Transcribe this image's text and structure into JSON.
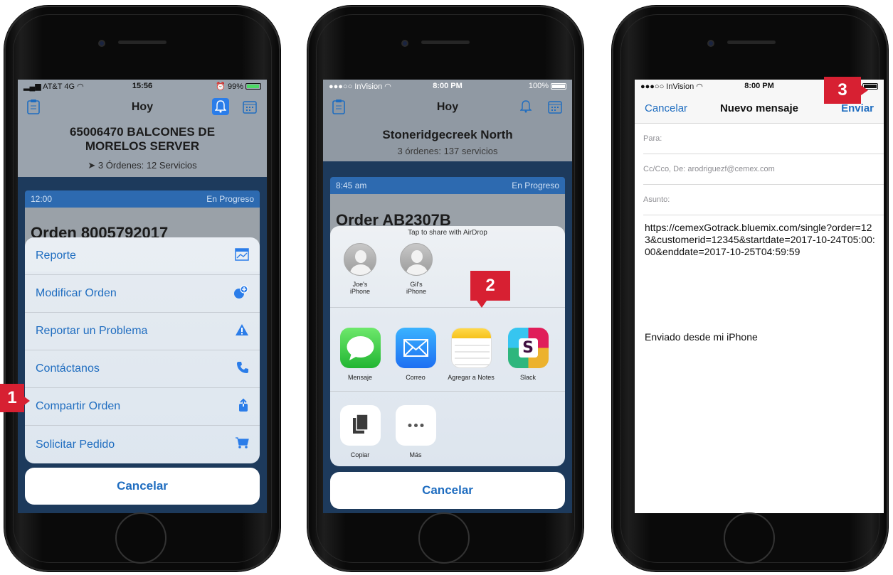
{
  "colors": {
    "accent": "#1f6dc0",
    "badge": "#d72032",
    "progress_bar": "#2d6ab0"
  },
  "phone1": {
    "status": {
      "carrier": "AT&T 4G",
      "time": "15:56",
      "battery": "99%"
    },
    "header_title": "Hoy",
    "site_name": "65006470 BALCONES DE MORELOS SERVER",
    "orders_summary": "3 Órdenes: 12 Servicios",
    "card_time": "12:00",
    "card_status": "En Progreso",
    "order_title": "Orden 8005792017",
    "menu": [
      {
        "label": "Reporte",
        "icon": "report-icon"
      },
      {
        "label": "Modificar Orden",
        "icon": "edit-order-icon"
      },
      {
        "label": "Reportar un Problema",
        "icon": "warning-icon"
      },
      {
        "label": "Contáctanos",
        "icon": "phone-icon"
      },
      {
        "label": "Compartir Orden",
        "icon": "share-icon"
      },
      {
        "label": "Solicitar Pedido",
        "icon": "cart-icon"
      }
    ],
    "cancel": "Cancelar",
    "step": "1"
  },
  "phone2": {
    "status": {
      "carrier": "●●●○○ InVision",
      "time": "8:00 PM",
      "battery": "100%"
    },
    "header_title": "Hoy",
    "site_name": "Stoneridgecreek North",
    "orders_summary": "3 órdenes: 137 servicios",
    "card_time": "8:45 am",
    "card_status": "En Progreso",
    "order_title": "Order AB2307B",
    "airdrop_hint": "Tap to share with AirDrop",
    "airdrop_people": [
      {
        "line1": "Joe's",
        "line2": "iPhone"
      },
      {
        "line1": "Gil's",
        "line2": "iPhone"
      }
    ],
    "share_apps": [
      "Mensaje",
      "Correo",
      "Agregar a Notes",
      "Slack"
    ],
    "actions": [
      "Copiar",
      "Más"
    ],
    "cancel": "Cancelar",
    "step": "2"
  },
  "phone3": {
    "status": {
      "carrier": "●●●○○ InVision",
      "time": "8:00 PM"
    },
    "nav": {
      "cancel": "Cancelar",
      "title": "Nuevo mensaje",
      "send": "Enviar"
    },
    "fields": {
      "to": "Para:",
      "cc": "Cc/Cco, De:  arodriguezf@cemex.com",
      "subject": "Asunto:"
    },
    "body_link": "https://cemexGotrack.bluemix.com/single?order=123&customerid=12345&startdate=2017-10-24T05:00:00&enddate=2017-10-25T04:59:59",
    "signature": "Enviado desde mi iPhone",
    "step": "3"
  }
}
